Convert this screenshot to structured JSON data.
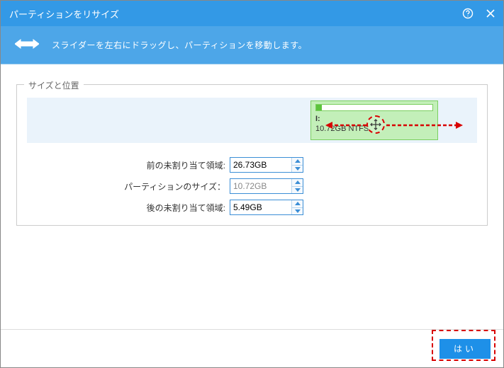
{
  "titlebar": {
    "title": "パーティションをリサイズ"
  },
  "instruction": {
    "text": "スライダーを左右にドラッグし、パーティションを移動します。"
  },
  "fieldset": {
    "legend": "サイズと位置"
  },
  "partition": {
    "drive": "I:",
    "size_text": "10.72GB NTFS"
  },
  "fields": {
    "before_label": "前の未割り当て領域:",
    "before_value": "26.73GB",
    "size_label": "パーティションのサイズ：",
    "size_value": "10.72GB",
    "after_label": "後の未割り当て領域:",
    "after_value": "5.49GB"
  },
  "footer": {
    "ok": "はい"
  }
}
